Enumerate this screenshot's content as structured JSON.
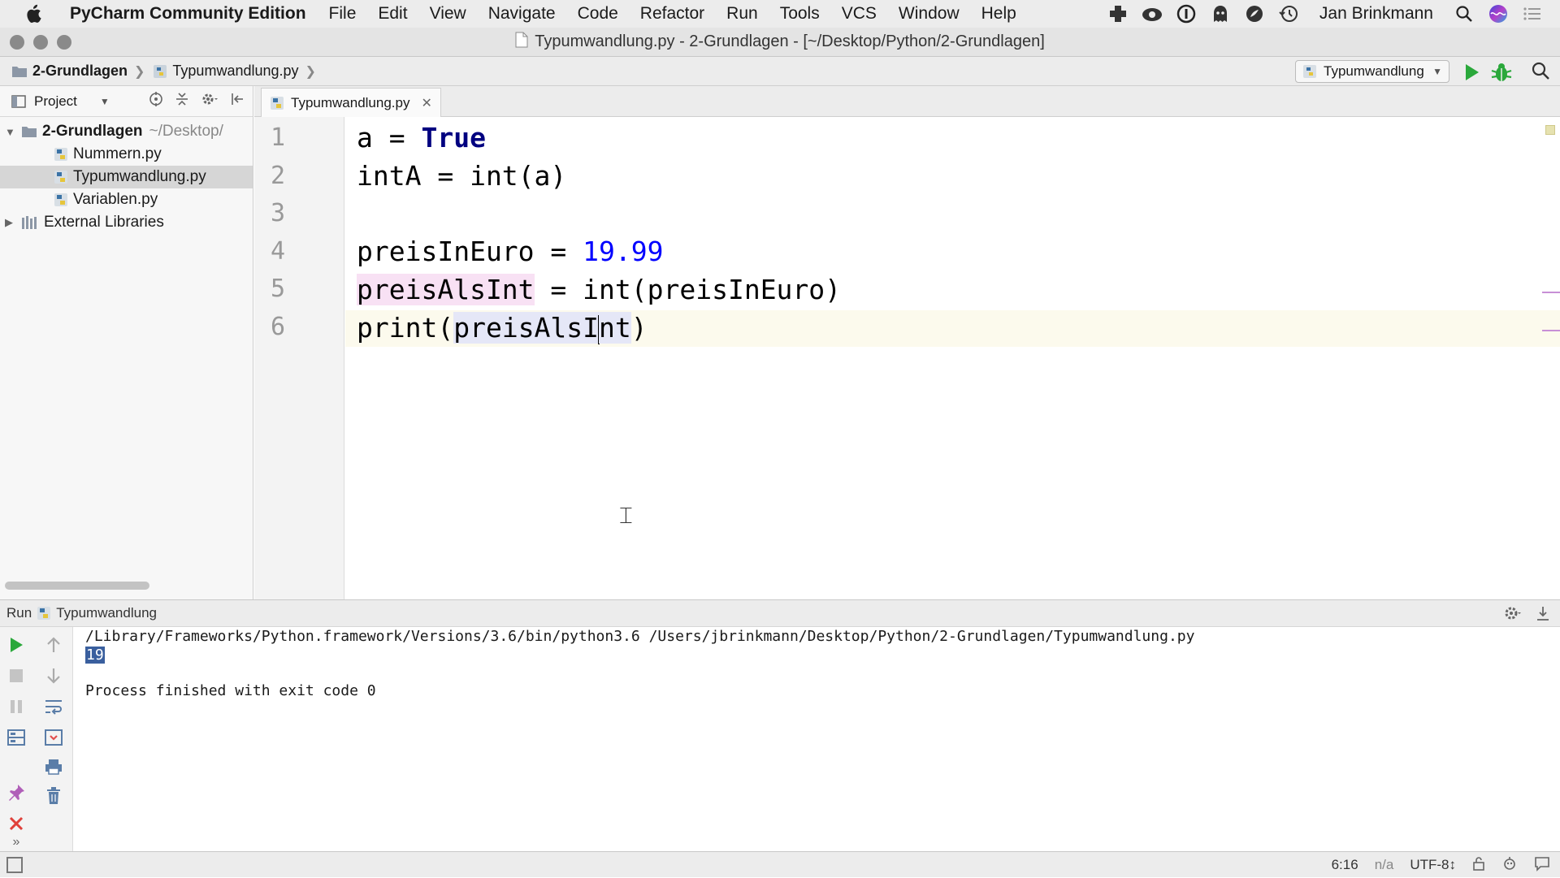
{
  "menubar": {
    "app_name": "PyCharm Community Edition",
    "items": [
      "File",
      "Edit",
      "View",
      "Navigate",
      "Code",
      "Refactor",
      "Run",
      "Tools",
      "VCS",
      "Window",
      "Help"
    ],
    "user": "Jan Brinkmann"
  },
  "window": {
    "title": "Typumwandlung.py - 2-Grundlagen - [~/Desktop/Python/2-Grundlagen]"
  },
  "navbar": {
    "breadcrumbs": [
      "2-Grundlagen",
      "Typumwandlung.py"
    ],
    "run_config": "Typumwandlung"
  },
  "project": {
    "header": "Project",
    "root_name": "2-Grundlagen",
    "root_path": "~/Desktop/",
    "files": [
      "Nummern.py",
      "Typumwandlung.py",
      "Variablen.py"
    ],
    "selected_file": "Typumwandlung.py",
    "external": "External Libraries"
  },
  "editor": {
    "tab": "Typumwandlung.py",
    "line_numbers": [
      "1",
      "2",
      "3",
      "4",
      "5",
      "6"
    ],
    "code": {
      "l1_a": "a = ",
      "l1_kw": "True",
      "l2": "intA = int(a)",
      "l4_a": "preisInEuro = ",
      "l4_num": "19.99",
      "l5_var": "preisAlsInt",
      "l5_rest": " = int(preisInEuro)",
      "l6_a": "print(",
      "l6_var1": "preisAlsI",
      "l6_var2": "nt",
      "l6_b": ")"
    },
    "cursor_position": "6:16"
  },
  "run": {
    "label": "Run",
    "config": "Typumwandlung",
    "command": "/Library/Frameworks/Python.framework/Versions/3.6/bin/python3.6 /Users/jbrinkmann/Desktop/Python/2-Grundlagen/Typumwandlung.py",
    "output": "19",
    "exit": "Process finished with exit code 0"
  },
  "status": {
    "position": "6:16",
    "line_sep": "n/a",
    "encoding": "UTF-8↕"
  },
  "colors": {
    "keyword": "#000080",
    "number": "#0000ff",
    "write_highlight": "#f8e1f4",
    "read_highlight": "#e5e7f7",
    "run_green": "#2aa83b",
    "stop_red": "#e0403a"
  }
}
